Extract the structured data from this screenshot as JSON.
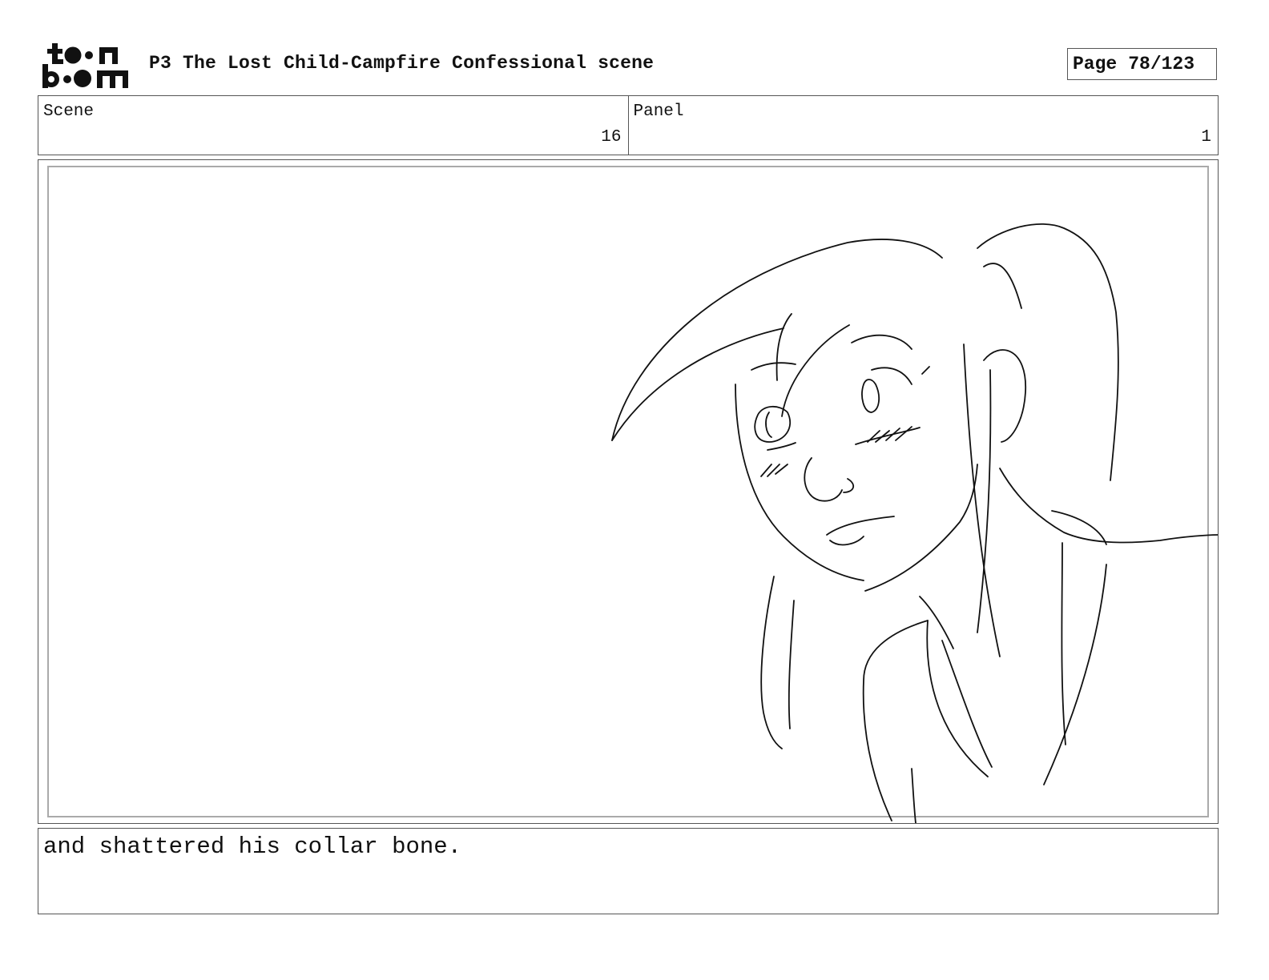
{
  "header": {
    "logo_name": "toon-boom-logo",
    "logo_text": "toon boom",
    "title": "P3 The Lost Child-Campfire Confessional scene",
    "page_label": "Page",
    "page_number": "78/123"
  },
  "info": {
    "scene_label": "Scene",
    "scene_value": "16",
    "panel_label": "Panel",
    "panel_value": "1"
  },
  "caption": {
    "text": "and shattered his collar bone."
  }
}
